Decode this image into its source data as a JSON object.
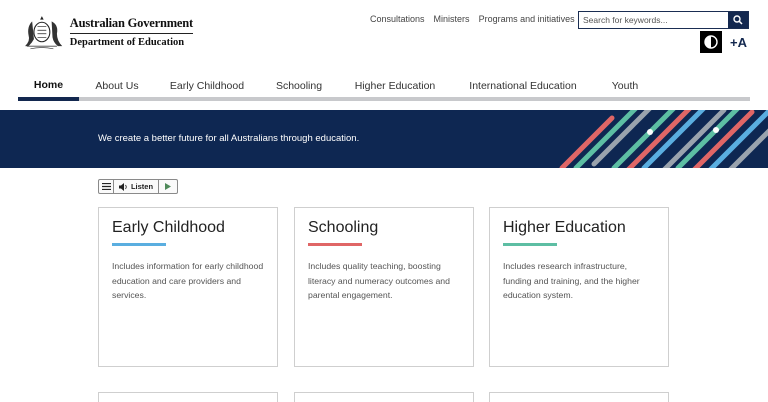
{
  "logo": {
    "government": "Australian Government",
    "department": "Department of Education"
  },
  "top_links": [
    "Consultations",
    "Ministers",
    "Programs and initiatives"
  ],
  "search": {
    "placeholder": "Search for keywords..."
  },
  "accessibility": {
    "font_label": "+A"
  },
  "nav": {
    "items": [
      {
        "label": "Home"
      },
      {
        "label": "About Us"
      },
      {
        "label": "Early Childhood"
      },
      {
        "label": "Schooling"
      },
      {
        "label": "Higher Education"
      },
      {
        "label": "International Education"
      },
      {
        "label": "Youth"
      }
    ]
  },
  "banner": {
    "text": "We create a better future for all Australians through education."
  },
  "listen": {
    "label": "Listen"
  },
  "cards": [
    {
      "title": "Early Childhood",
      "accent": "#5aaee0",
      "description": "Includes information for early childhood education and care providers and services."
    },
    {
      "title": "Schooling",
      "accent": "#e06666",
      "description": "Includes quality teaching, boosting literacy and numeracy outcomes and parental engagement."
    },
    {
      "title": "Higher Education",
      "accent": "#5dbea3",
      "description": "Includes research infrastructure, funding and training, and the higher education system."
    }
  ],
  "colors": {
    "navy": "#13284f",
    "banner": "#0e2752"
  }
}
